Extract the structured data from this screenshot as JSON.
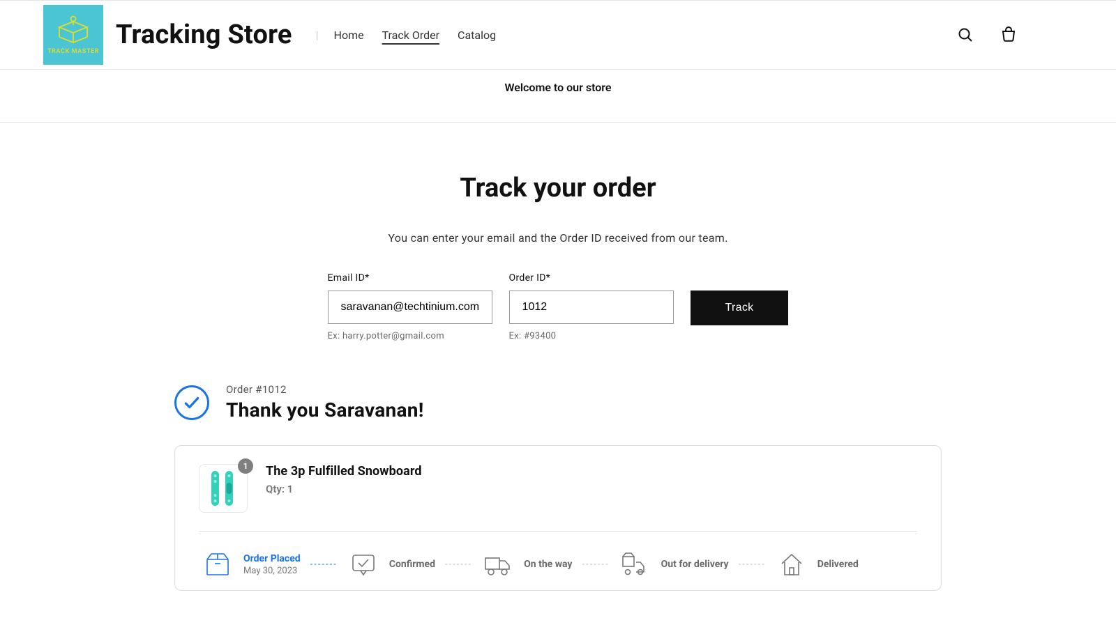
{
  "header": {
    "logo_text": "TRACK MASTER",
    "store_name": "Tracking Store",
    "nav": {
      "home": "Home",
      "track_order": "Track Order",
      "catalog": "Catalog"
    }
  },
  "announcement": "Welcome to our store",
  "track_section": {
    "title": "Track your order",
    "subtitle": "You can enter your email and the Order ID received from our team.",
    "email_label": "Email ID*",
    "email_value": "saravanan@techtinium.com",
    "email_hint": "Ex: harry.potter@gmail.com",
    "order_label": "Order ID*",
    "order_value": "1012",
    "order_hint": "Ex: #93400",
    "track_button": "Track"
  },
  "order": {
    "label": "Order #1012",
    "thank_you": "Thank you Saravanan!",
    "product": {
      "qty_badge": "1",
      "name": "The 3p Fulfilled Snowboard",
      "qty_text": "Qty: 1"
    },
    "stages": {
      "placed": {
        "title": "Order Placed",
        "date": "May 30, 2023"
      },
      "confirmed": {
        "title": "Confirmed"
      },
      "on_the_way": {
        "title": "On the way"
      },
      "out_for_delivery": {
        "title": "Out for delivery"
      },
      "delivered": {
        "title": "Delivered"
      }
    }
  }
}
